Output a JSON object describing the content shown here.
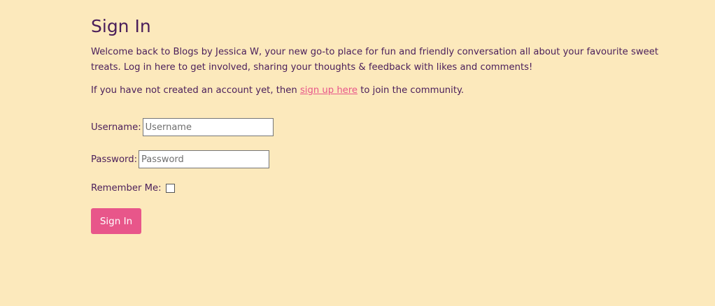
{
  "page": {
    "title": "Sign In",
    "intro": "Welcome back to Blogs by Jessica W, your new go-to place for fun and friendly conversation all about your favourite sweet treats. Log in here to get involved, sharing your thoughts & feedback with likes and comments!",
    "signup_prefix": "If you have not created an account yet, then ",
    "signup_link": "sign up here",
    "signup_suffix": " to join the community."
  },
  "form": {
    "username_label": "Username:",
    "username_placeholder": "Username",
    "username_value": "",
    "password_label": "Password:",
    "password_placeholder": "Password",
    "password_value": "",
    "remember_label": "Remember Me:",
    "remember_checked": false,
    "submit_label": "Sign In"
  },
  "colors": {
    "background": "#fce9bc",
    "text": "#4a1e5a",
    "accent": "#e8568a"
  }
}
